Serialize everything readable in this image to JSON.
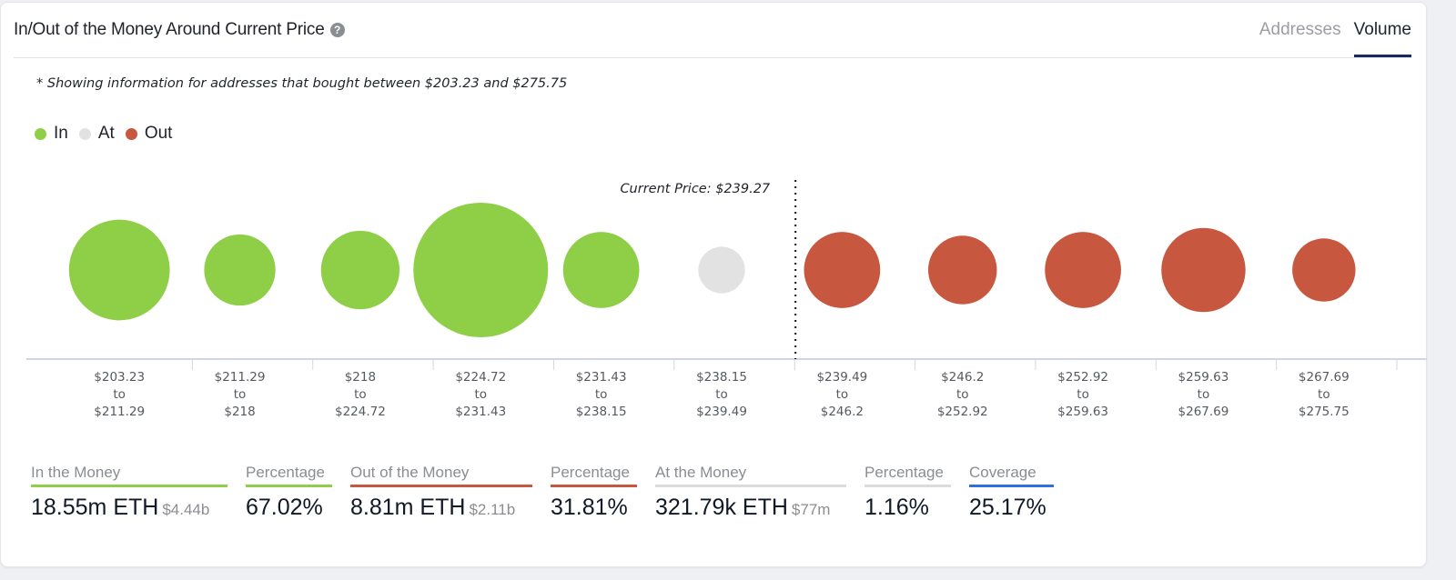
{
  "header": {
    "title": "In/Out of the Money Around Current Price",
    "help_icon": "question-circle-icon",
    "tabs": [
      {
        "label": "Addresses",
        "active": false
      },
      {
        "label": "Volume",
        "active": true
      }
    ]
  },
  "note": "* Showing information for addresses that bought between $203.23 and $275.75",
  "legend": [
    {
      "label": "In",
      "color": "#8fcf47"
    },
    {
      "label": "At",
      "color": "#e2e2e2"
    },
    {
      "label": "Out",
      "color": "#c8573f"
    }
  ],
  "chart_data": {
    "type": "bubble",
    "title": "In/Out of the Money Around Current Price",
    "current_price_label": "Current Price: $239.27",
    "current_price": 239.27,
    "current_price_after_category_index": 5,
    "categories": [
      {
        "from": "$203.23",
        "to": "$211.29",
        "status": "In",
        "relative_size": 0.56
      },
      {
        "from": "$211.29",
        "to": "$218",
        "status": "In",
        "relative_size": 0.28
      },
      {
        "from": "$218",
        "to": "$224.72",
        "status": "In",
        "relative_size": 0.34
      },
      {
        "from": "$224.72",
        "to": "$231.43",
        "status": "In",
        "relative_size": 1.0
      },
      {
        "from": "$231.43",
        "to": "$238.15",
        "status": "In",
        "relative_size": 0.32
      },
      {
        "from": "$238.15",
        "to": "$239.49",
        "status": "At",
        "relative_size": 0.12
      },
      {
        "from": "$239.49",
        "to": "$246.2",
        "status": "Out",
        "relative_size": 0.32
      },
      {
        "from": "$246.2",
        "to": "$252.92",
        "status": "Out",
        "relative_size": 0.26
      },
      {
        "from": "$252.92",
        "to": "$259.63",
        "status": "Out",
        "relative_size": 0.32
      },
      {
        "from": "$259.63",
        "to": "$267.69",
        "status": "Out",
        "relative_size": 0.39
      },
      {
        "from": "$267.69",
        "to": "$275.75",
        "status": "Out",
        "relative_size": 0.22
      }
    ],
    "range_word": "to",
    "colors": {
      "In": "#8fcf47",
      "At": "#e2e2e2",
      "Out": "#c8573f"
    }
  },
  "stats": [
    {
      "label": "In the Money",
      "value": "18.55m ETH",
      "sub": "$4.44b",
      "color": "#8fcf47"
    },
    {
      "label": "Percentage",
      "value": "67.02%",
      "sub": "",
      "color": "#8fcf47"
    },
    {
      "label": "Out of the Money",
      "value": "8.81m ETH",
      "sub": "$2.11b",
      "color": "#c8573f"
    },
    {
      "label": "Percentage",
      "value": "31.81%",
      "sub": "",
      "color": "#c8573f"
    },
    {
      "label": "At the Money",
      "value": "321.79k ETH",
      "sub": "$77m",
      "color": "#dcdcdc"
    },
    {
      "label": "Percentage",
      "value": "1.16%",
      "sub": "",
      "color": "#dcdcdc"
    },
    {
      "label": "Coverage",
      "value": "25.17%",
      "sub": "",
      "color": "#2f6fe0"
    }
  ]
}
